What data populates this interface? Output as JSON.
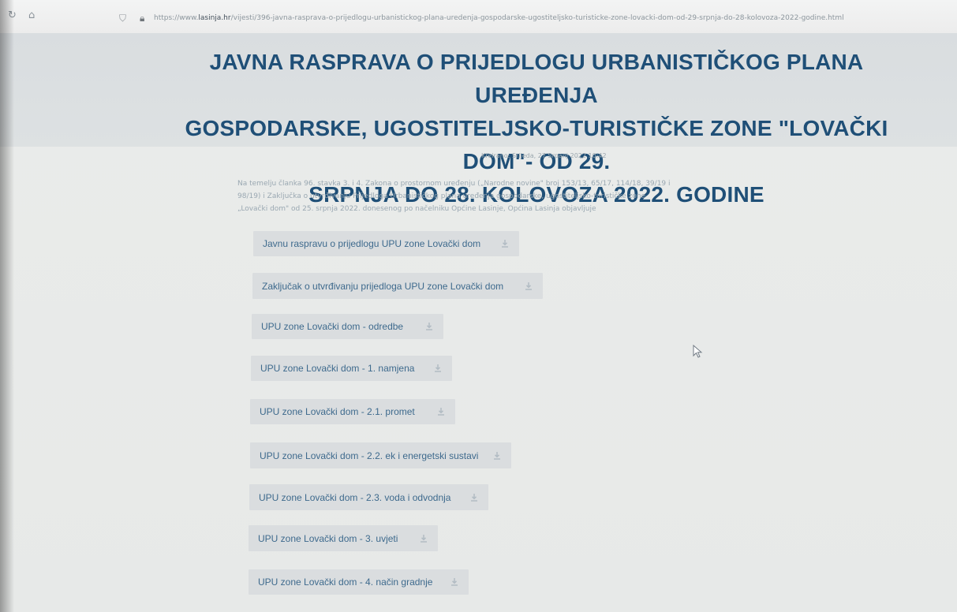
{
  "browser": {
    "url_prefix": "https://www.",
    "url_domain": "lasinja.hr",
    "url_rest": "/vijesti/396-javna-rasprava-o-prijedlogu-urbanistickog-plana-uredenja-gospodarske-ugostiteljsko-turisticke-zone-lovacki-dom-od-29-srpnja-do-28-kolovoza-2022-godine.html"
  },
  "article": {
    "title_line_1": "JAVNA RASPRAVA O PRIJEDLOGU URBANISTIČKOG PLANA UREĐENJA",
    "title_line_2": "GOSPODARSKE, UGOSTITELJSKO-TURISTIČKE ZONE \"LOVAČKI DOM\"- OD 29.",
    "title_line_3": "SRPNJA DO 28. KOLOVOZA 2022. GODINE",
    "created": "Kreirano: Srijeda, 27 Srpanj 2022 10:42",
    "intro_line_1": "Na temelju članka 96. stavka 3. i 4. Zakona o prostornom uređenju („Narodne novine\" broj 153/13, 65/17, 114/18, 39/19 i",
    "intro_line_2": "98/19) i Zaključka o utvrđivanju Prijedloga Urbanističkog plana uređenja gospodarske, ugostiteljsko-turističke zone",
    "intro_line_3": "„Lovački dom\" od 25. srpnja 2022. donesenog po načelniku Općine Lasinje, Općina Lasinja objavljuje"
  },
  "documents": [
    {
      "label": "Javnu raspravu o prijedlogu UPU zone Lovački dom"
    },
    {
      "label": "Zaključak o utvrđivanju prijedloga UPU zone Lovački dom"
    },
    {
      "label": "UPU zone Lovački dom - odredbe"
    },
    {
      "label": "UPU zone Lovački dom - 1. namjena"
    },
    {
      "label": "UPU zone Lovački dom - 2.1. promet"
    },
    {
      "label": "UPU zone Lovački dom - 2.2. ek i energetski sustavi"
    },
    {
      "label": "UPU zone Lovački dom - 2.3. voda i odvodnja"
    },
    {
      "label": "UPU zone Lovački dom - 3. uvjeti"
    },
    {
      "label": "UPU zone Lovački dom - 4. način gradnje"
    }
  ],
  "icons": {
    "reload": "reload-icon",
    "home": "home-icon",
    "shield": "shield-icon",
    "lock": "lock-icon",
    "download": "download-icon",
    "cursor": "mouse-cursor-icon"
  },
  "colors": {
    "title": "#1f4f77",
    "button_bg": "#dadddf",
    "button_text": "#3e6a8d",
    "page_bg": "#e9ebea"
  }
}
